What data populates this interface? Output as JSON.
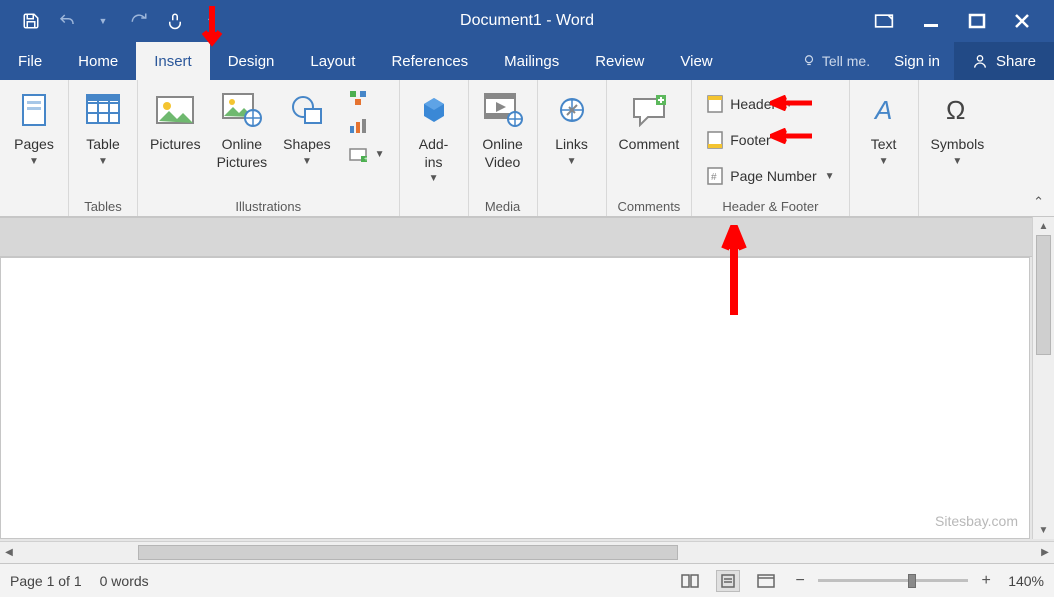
{
  "app": {
    "title": "Document1 - Word"
  },
  "menu": {
    "file": "File",
    "home": "Home",
    "insert": "Insert",
    "design": "Design",
    "layout": "Layout",
    "references": "References",
    "mailings": "Mailings",
    "review": "Review",
    "view": "View",
    "tell_me": "Tell me.",
    "sign_in": "Sign in",
    "share": "Share"
  },
  "ribbon": {
    "pages": {
      "label": "Pages"
    },
    "tables": {
      "btn": "Table",
      "group": "Tables"
    },
    "illustrations": {
      "group": "Illustrations",
      "pictures": "Pictures",
      "online_pictures": "Online\nPictures",
      "shapes": "Shapes"
    },
    "addins": {
      "btn": "Add-\nins",
      "group": ""
    },
    "media": {
      "btn": "Online\nVideo",
      "group": "Media"
    },
    "links": {
      "btn": "Links",
      "group": ""
    },
    "comments": {
      "btn": "Comment",
      "group": "Comments"
    },
    "header_footer": {
      "group": "Header & Footer",
      "header": "Header",
      "footer": "Footer",
      "page_number": "Page Number"
    },
    "text": {
      "btn": "Text",
      "group": ""
    },
    "symbols": {
      "btn": "Symbols",
      "group": ""
    }
  },
  "status": {
    "page": "Page 1 of 1",
    "words": "0 words",
    "zoom": "140%"
  },
  "watermark": "Sitesbay.com"
}
